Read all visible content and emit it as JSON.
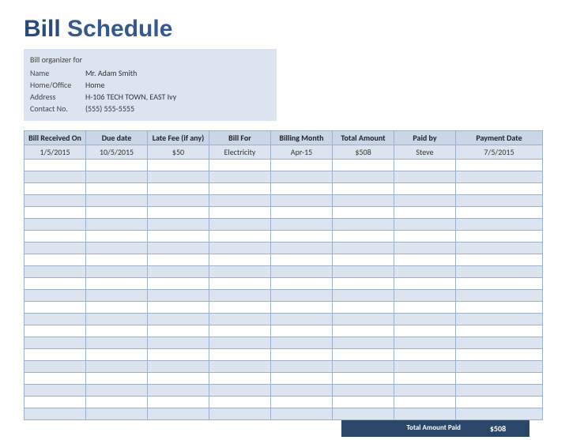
{
  "title": {
    "first": "Bill",
    "rest": "Schedule"
  },
  "info": {
    "subtitle": "Bill organizer for",
    "name_label": "Name",
    "name_value": "Mr. Adam Smith",
    "home_label": "Home/Office",
    "home_value": "Home",
    "address_label": "Address",
    "address_value": "H-106 TECH TOWN, EAST Ivy",
    "contact_label": "Contact No.",
    "contact_value": "(555) 555-5555"
  },
  "columns": [
    "Bill Received On",
    "Due date",
    "Late Fee (if any)",
    "Bill For",
    "Billing Month",
    "Total Amount",
    "Paid by",
    "Payment Date"
  ],
  "rows": [
    {
      "received": "1/5/2015",
      "due": "10/5/2015",
      "latefee": "$50",
      "billfor": "Electricity",
      "month": "Apr-15",
      "total": "$508",
      "paidby": "Steve",
      "paydate": "7/5/2015"
    }
  ],
  "blank_rows": 22,
  "footer": {
    "label": "Total Amount Paid",
    "value": "$508"
  }
}
